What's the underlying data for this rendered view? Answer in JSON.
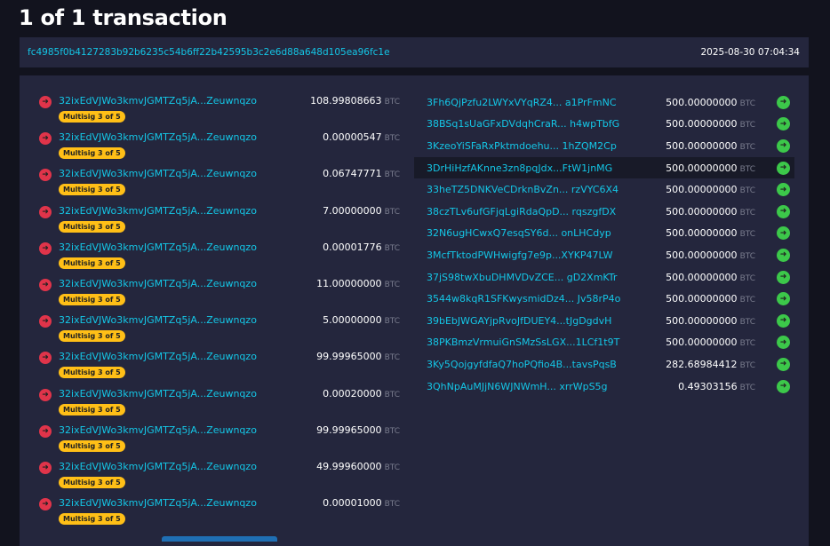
{
  "title": "1 of 1 transaction",
  "txid": "fc4985f0b4127283b92b6235c54b6ff22b42595b3c2e6d88a648d105ea96fc1e",
  "timestamp": "2025-08-30 07:04:34",
  "unit": "BTC",
  "inputs": [
    {
      "address": "32ixEdVJWo3kmvJGMTZq5jA...Zeuwnqzo",
      "amount": "108.99808663",
      "badge": "Multisig 3 of 5"
    },
    {
      "address": "32ixEdVJWo3kmvJGMTZq5jA...Zeuwnqzo",
      "amount": "0.00000547",
      "badge": "Multisig 3 of 5"
    },
    {
      "address": "32ixEdVJWo3kmvJGMTZq5jA...Zeuwnqzo",
      "amount": "0.06747771",
      "badge": "Multisig 3 of 5"
    },
    {
      "address": "32ixEdVJWo3kmvJGMTZq5jA...Zeuwnqzo",
      "amount": "7.00000000",
      "badge": "Multisig 3 of 5"
    },
    {
      "address": "32ixEdVJWo3kmvJGMTZq5jA...Zeuwnqzo",
      "amount": "0.00001776",
      "badge": "Multisig 3 of 5"
    },
    {
      "address": "32ixEdVJWo3kmvJGMTZq5jA...Zeuwnqzo",
      "amount": "11.00000000",
      "badge": "Multisig 3 of 5"
    },
    {
      "address": "32ixEdVJWo3kmvJGMTZq5jA...Zeuwnqzo",
      "amount": "5.00000000",
      "badge": "Multisig 3 of 5"
    },
    {
      "address": "32ixEdVJWo3kmvJGMTZq5jA...Zeuwnqzo",
      "amount": "99.99965000",
      "badge": "Multisig 3 of 5"
    },
    {
      "address": "32ixEdVJWo3kmvJGMTZq5jA...Zeuwnqzo",
      "amount": "0.00020000",
      "badge": "Multisig 3 of 5"
    },
    {
      "address": "32ixEdVJWo3kmvJGMTZq5jA...Zeuwnqzo",
      "amount": "99.99965000",
      "badge": "Multisig 3 of 5"
    },
    {
      "address": "32ixEdVJWo3kmvJGMTZq5jA...Zeuwnqzo",
      "amount": "49.99960000",
      "badge": "Multisig 3 of 5"
    },
    {
      "address": "32ixEdVJWo3kmvJGMTZq5jA...Zeuwnqzo",
      "amount": "0.00001000",
      "badge": "Multisig 3 of 5"
    }
  ],
  "outputs": [
    {
      "address": "3Fh6QjPzfu2LWYxVYqRZ4... a1PrFmNC",
      "amount": "500.00000000"
    },
    {
      "address": "38BSq1sUaGFxDVdqhCraR... h4wpTbfG",
      "amount": "500.00000000"
    },
    {
      "address": "3KzeoYiSFaRxPktmdoehu... 1hZQM2Cp",
      "amount": "500.00000000"
    },
    {
      "address": "3DrHiHzfAKnne3zn8pqJdx...FtW1jnMG",
      "amount": "500.00000000"
    },
    {
      "address": "33heTZ5DNKVeCDrknBvZn... rzVYC6X4",
      "amount": "500.00000000"
    },
    {
      "address": "38czTLv6ufGFjqLgiRdaQpD... rqszgfDX",
      "amount": "500.00000000"
    },
    {
      "address": "32N6ugHCwxQ7esqSY6d... onLHCdyp",
      "amount": "500.00000000"
    },
    {
      "address": "3McfTktodPWHwigfg7e9p...XYKP47LW",
      "amount": "500.00000000"
    },
    {
      "address": "37jS98twXbuDHMVDvZCE... gD2XmKTr",
      "amount": "500.00000000"
    },
    {
      "address": "3544w8kqR1SFKwysmidDz4... Jv58rP4o",
      "amount": "500.00000000"
    },
    {
      "address": "39bEbJWGAYjpRvoJfDUEY4...tJgDgdvH",
      "amount": "500.00000000"
    },
    {
      "address": "38PKBmzVrmuiGnSMzSsLGX...1LCf1t9T",
      "amount": "500.00000000"
    },
    {
      "address": "3Ky5QojgyfdfaQ7hoPQfio4B...tavsPqsB",
      "amount": "282.68984412"
    },
    {
      "address": "3QhNpAuMJjN6WJNWmH... xrrWpS5g",
      "amount": "0.49303156"
    }
  ]
}
